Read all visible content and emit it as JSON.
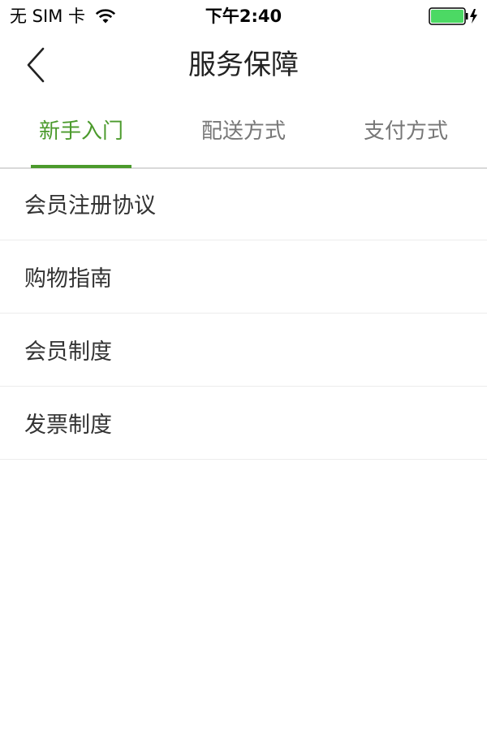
{
  "status_bar": {
    "carrier": "无 SIM 卡",
    "time": "下午2:40",
    "battery_color": "#4cd964",
    "wifi_icon": "wifi-icon",
    "charging_icon": "lightning-icon"
  },
  "nav": {
    "back_icon": "chevron-left-icon",
    "title": "服务保障"
  },
  "tabs": [
    {
      "label": "新手入门",
      "active": true
    },
    {
      "label": "配送方式",
      "active": false
    },
    {
      "label": "支付方式",
      "active": false
    }
  ],
  "accent_color": "#4b9a2c",
  "list": [
    {
      "label": "会员注册协议"
    },
    {
      "label": "购物指南"
    },
    {
      "label": "会员制度"
    },
    {
      "label": "发票制度"
    }
  ]
}
